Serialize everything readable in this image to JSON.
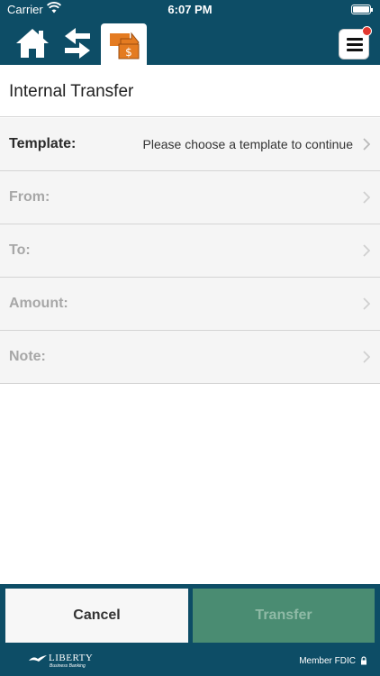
{
  "status_bar": {
    "carrier": "Carrier",
    "time": "6:07 PM"
  },
  "nav": {
    "icons": [
      "home-icon",
      "transfer-arrows-icon",
      "internal-transfer-icon",
      "hamburger-menu-icon"
    ],
    "active_tab": "internal-transfer"
  },
  "page": {
    "title": "Internal Transfer"
  },
  "form": {
    "template": {
      "label": "Template:",
      "value": "Please choose a template to continue"
    },
    "from": {
      "label": "From:",
      "value": ""
    },
    "to": {
      "label": "To:",
      "value": ""
    },
    "amount": {
      "label": "Amount:",
      "value": ""
    },
    "note": {
      "label": "Note:",
      "value": ""
    }
  },
  "actions": {
    "cancel_label": "Cancel",
    "transfer_label": "Transfer"
  },
  "footer": {
    "brand": "LIBERTY",
    "brand_sub": "Business Banking",
    "member": "Member FDIC"
  },
  "colors": {
    "primary": "#0d4d66",
    "accent": "#e47b21",
    "transfer_button": "#4a8c72",
    "badge": "#e2382f"
  }
}
